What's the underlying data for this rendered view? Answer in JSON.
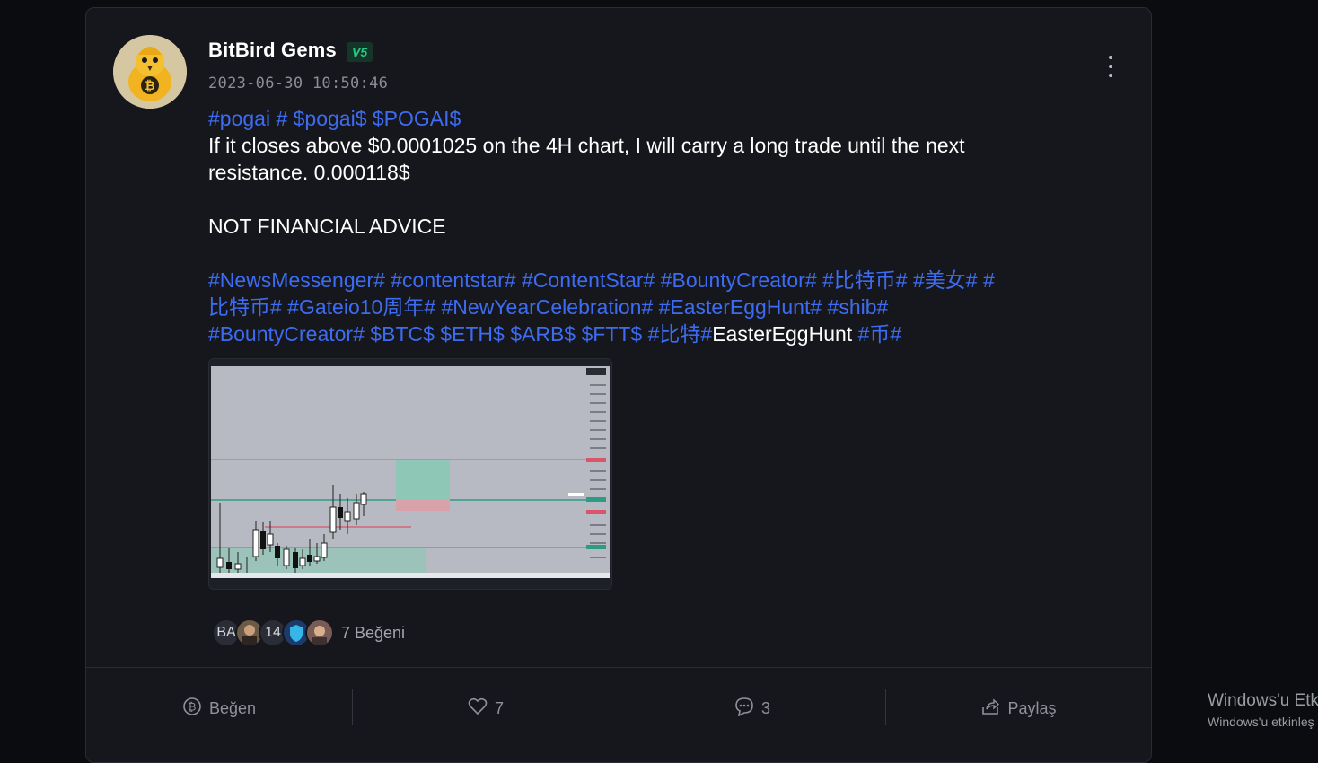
{
  "post": {
    "username": "BitBird Gems",
    "vip_badge": "V5",
    "timestamp": "2023-06-30 10:50:46",
    "tag_line": "#pogai # $pogai$ $POGAI$",
    "text_line1": "If it closes above $0.0001025 on the 4H chart, I will carry a long trade until the next",
    "text_line2": "resistance. 0.000118$",
    "text_line3": "NOT FINANCIAL ADVICE",
    "hashtags_line1": "#NewsMessenger# #contentstar# #ContentStar# #BountyCreator# #比特币# #美女# #",
    "hashtags_line2": "比特币# #Gateio10周年# #NewYearCelebration# #EasterEggHunt# #shib#",
    "hashtags_line3_tags": "#BountyCreator# $BTC$ $ETH$ $ARB$ $FTT$ #比特#",
    "hashtags_line3_plain": "EasterEggHunt",
    "hashtags_line3_end": "#币#"
  },
  "likers": {
    "initials1": "BA",
    "initials2": "14",
    "count_label": "7 Beğeni"
  },
  "actions": {
    "like_label": "Beğen",
    "heart_count": "7",
    "comment_count": "3",
    "share_label": "Paylaş"
  },
  "watermark": {
    "line1": "Windows'u Etk",
    "line2": "Windows'u etkinleş"
  },
  "colors": {
    "background": "#0b0c0f",
    "card": "#16171c",
    "link": "#3d6cf2",
    "vip": "#27c98a"
  }
}
